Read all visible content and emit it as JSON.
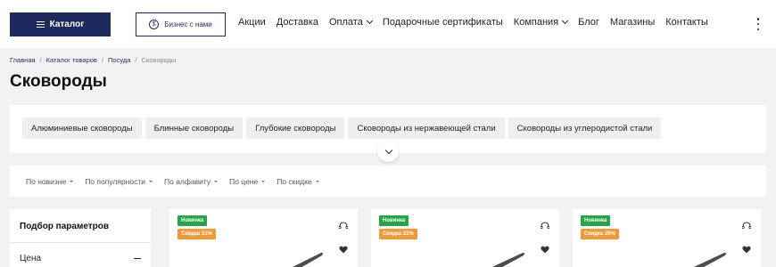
{
  "header": {
    "catalog_label": "Каталог",
    "business_label": "Бизнес с нами",
    "nav": [
      {
        "label": "Акции",
        "dropdown": false
      },
      {
        "label": "Доставка",
        "dropdown": false
      },
      {
        "label": "Оплата",
        "dropdown": true
      },
      {
        "label": "Подарочные сертификаты",
        "dropdown": false
      },
      {
        "label": "Компания",
        "dropdown": true
      },
      {
        "label": "Блог",
        "dropdown": false
      },
      {
        "label": "Магазины",
        "dropdown": false
      },
      {
        "label": "Контакты",
        "dropdown": false
      }
    ]
  },
  "breadcrumb": [
    "Главная",
    "Каталог товаров",
    "Посуда",
    "Сковороды"
  ],
  "page_title": "Сковороды",
  "categories": [
    "Алюминиевые сковороды",
    "Блинные сковороды",
    "Глубокие сковороды",
    "Сковороды из нержавеющей стали",
    "Сковороды из углеродистой стали"
  ],
  "sort": [
    "По новизне",
    "По популярности",
    "По алфавиту",
    "По цене",
    "По скидке"
  ],
  "filters": {
    "title": "Подбор параметров",
    "price_label": "Цена"
  },
  "products": [
    {
      "badge_new": "Новинка",
      "badge_sale": "Скидка 21%"
    },
    {
      "badge_new": "Новинка",
      "badge_sale": "Скидка 22%"
    },
    {
      "badge_new": "Новинка",
      "badge_sale": "Скидка 20%"
    }
  ],
  "colors": {
    "brand": "#1f2a5c",
    "badge_new": "#27a34a",
    "badge_sale": "#ee9a3a"
  }
}
